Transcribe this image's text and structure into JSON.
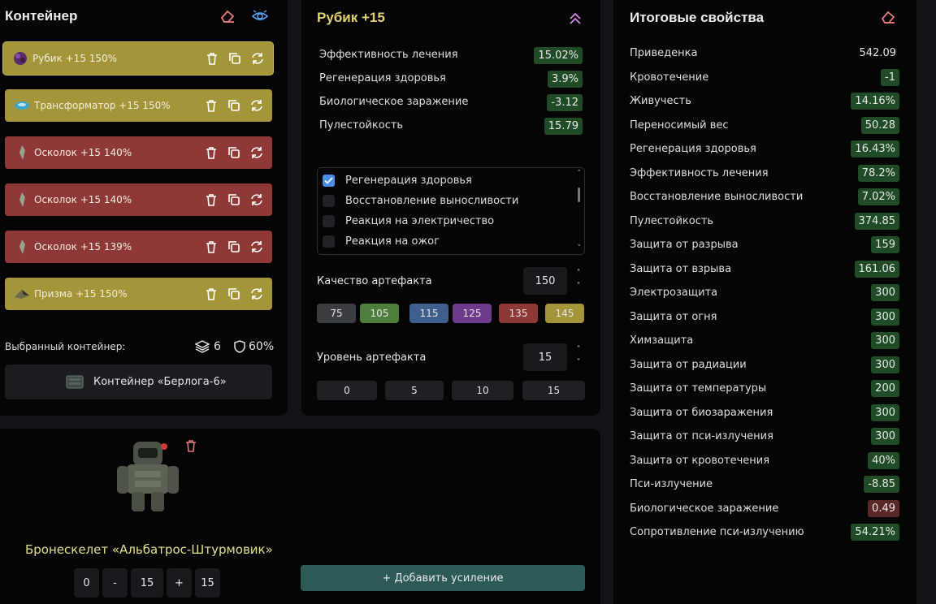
{
  "container": {
    "title": "Контейнер",
    "slots": [
      {
        "name": "Рубик",
        "level": "+15",
        "quality": "150%",
        "color": "gold",
        "icon": "rubik-icon"
      },
      {
        "name": "Трансформатор",
        "level": "+15",
        "quality": "150%",
        "color": "gold",
        "icon": "transformer-icon"
      },
      {
        "name": "Осколок",
        "level": "+15",
        "quality": "140%",
        "color": "red",
        "icon": "shard-icon"
      },
      {
        "name": "Осколок",
        "level": "+15",
        "quality": "140%",
        "color": "red",
        "icon": "shard-icon"
      },
      {
        "name": "Осколок",
        "level": "+15",
        "quality": "139%",
        "color": "red",
        "icon": "shard-icon"
      },
      {
        "name": "Призма",
        "level": "+15",
        "quality": "150%",
        "color": "gold",
        "icon": "prism-icon"
      }
    ],
    "selected_label": "Выбранный контейнер:",
    "slot_count": "6",
    "protection": "60%",
    "container_name": "Контейнер «Берлога-6»"
  },
  "artifact": {
    "title": "Рубик +15",
    "stats": [
      {
        "label": "Эффективность лечения",
        "value": "15.02%"
      },
      {
        "label": "Регенерация здоровья",
        "value": "3.9%"
      },
      {
        "label": "Биологическое заражение",
        "value": "-3.12"
      },
      {
        "label": "Пулестойкость",
        "value": "15.79"
      }
    ],
    "options": [
      {
        "label": "Регенерация здоровья",
        "checked": true
      },
      {
        "label": "Восстановление выносливости",
        "checked": false
      },
      {
        "label": "Реакция на электричество",
        "checked": false
      },
      {
        "label": "Реакция на ожог",
        "checked": false
      }
    ],
    "quality_label": "Качество артефакта",
    "quality_value": "150",
    "quality_presets": [
      {
        "label": "75",
        "color": "#3a3d42"
      },
      {
        "label": "105",
        "color": "#4f7d3b"
      },
      {
        "label": "115",
        "color": "#3f5f8e"
      },
      {
        "label": "125",
        "color": "#6e3a8c"
      },
      {
        "label": "135",
        "color": "#8f3838"
      },
      {
        "label": "145",
        "color": "#a3953a"
      }
    ],
    "level_label": "Уровень артефакта",
    "level_value": "15",
    "level_presets": [
      "0",
      "5",
      "10",
      "15"
    ]
  },
  "armor": {
    "name": "Бронескелет «Альбатрос-Штурмовик»",
    "min": "0",
    "minus": "-",
    "value": "15",
    "plus": "+",
    "max": "15",
    "add_button": "+ Добавить усиление"
  },
  "totals": {
    "title": "Итоговые свойства",
    "rows": [
      {
        "label": "Приведенка",
        "value": "542.09",
        "style": "plain"
      },
      {
        "label": "Кровотечение",
        "value": "-1",
        "style": "pos"
      },
      {
        "label": "Живучесть",
        "value": "14.16%",
        "style": "pos"
      },
      {
        "label": "Переносимый вес",
        "value": "50.28",
        "style": "pos"
      },
      {
        "label": "Регенерация здоровья",
        "value": "16.43%",
        "style": "pos"
      },
      {
        "label": "Эффективность лечения",
        "value": "78.2%",
        "style": "pos"
      },
      {
        "label": "Восстановление выносливости",
        "value": "7.02%",
        "style": "pos"
      },
      {
        "label": "Пулестойкость",
        "value": "374.85",
        "style": "pos"
      },
      {
        "label": "Защита от разрыва",
        "value": "159",
        "style": "pos"
      },
      {
        "label": "Защита от взрыва",
        "value": "161.06",
        "style": "pos"
      },
      {
        "label": "Электрозащита",
        "value": "300",
        "style": "pos"
      },
      {
        "label": "Защита от огня",
        "value": "300",
        "style": "pos"
      },
      {
        "label": "Химзащита",
        "value": "300",
        "style": "pos"
      },
      {
        "label": "Защита от радиации",
        "value": "300",
        "style": "pos"
      },
      {
        "label": "Защита от температуры",
        "value": "200",
        "style": "pos"
      },
      {
        "label": "Защита от биозаражения",
        "value": "300",
        "style": "pos"
      },
      {
        "label": "Защита от пси-излучения",
        "value": "300",
        "style": "pos"
      },
      {
        "label": "Защита от кровотечения",
        "value": "40%",
        "style": "pos"
      },
      {
        "label": "Пси-излучение",
        "value": "-8.85",
        "style": "pos"
      },
      {
        "label": "Биологическое заражение",
        "value": "0.49",
        "style": "neg"
      },
      {
        "label": "Сопротивление пси-излучению",
        "value": "54.21%",
        "style": "pos"
      }
    ]
  },
  "colors": {
    "gold": "#a3953a",
    "red": "#8f3838",
    "positive": "#1f4b26",
    "negative": "#5a2828",
    "accent": "#e2d36a",
    "button": "#2c5a57"
  }
}
